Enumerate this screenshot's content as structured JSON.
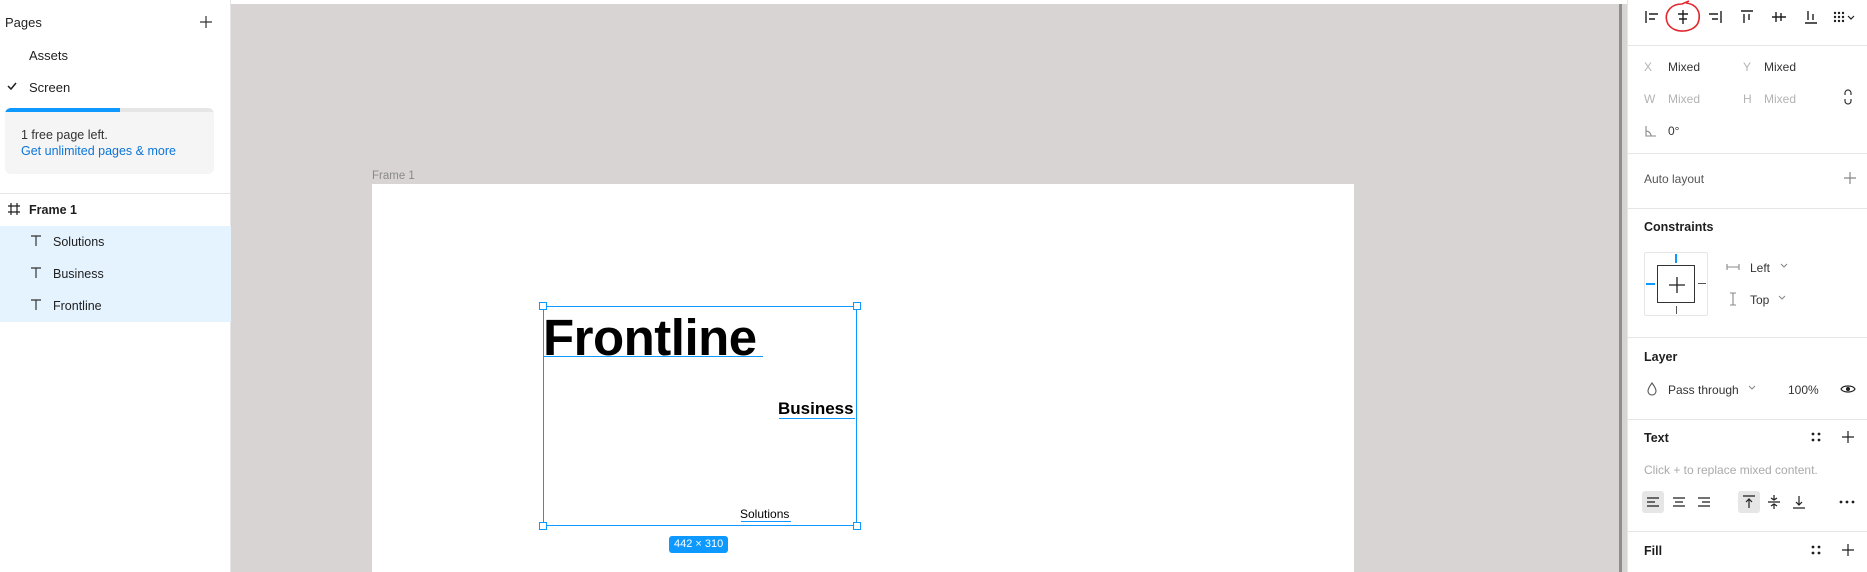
{
  "left_panel": {
    "pages_title": "Pages",
    "pages": [
      {
        "label": "Assets",
        "checked": false
      },
      {
        "label": "Screen",
        "checked": true
      }
    ],
    "quota": {
      "progress": 0.55,
      "message": "1 free page left.",
      "link": "Get unlimited pages & more"
    },
    "layers": [
      {
        "label": "Frame 1",
        "type": "frame",
        "selected": false
      },
      {
        "label": "Solutions",
        "type": "text",
        "selected": true
      },
      {
        "label": "Business",
        "type": "text",
        "selected": true
      },
      {
        "label": "Frontline",
        "type": "text",
        "selected": true
      }
    ]
  },
  "canvas": {
    "frame_label": "Frame 1",
    "texts": {
      "frontline": "Frontline",
      "business": "Business",
      "solutions": "Solutions"
    },
    "selection_size": "442 × 310"
  },
  "right_panel": {
    "position": {
      "x_label": "X",
      "x_value": "Mixed",
      "y_label": "Y",
      "y_value": "Mixed",
      "w_label": "W",
      "w_value": "Mixed",
      "h_label": "H",
      "h_value": "Mixed",
      "rotation": "0°"
    },
    "auto_layout_title": "Auto layout",
    "constraints": {
      "title": "Constraints",
      "horizontal": "Left",
      "vertical": "Top"
    },
    "layer": {
      "title": "Layer",
      "blend": "Pass through",
      "opacity": "100%"
    },
    "text": {
      "title": "Text",
      "hint": "Click + to replace mixed content."
    },
    "fill": {
      "title": "Fill"
    },
    "colors": {
      "accent": "#0d99ff",
      "canvas": "#d9d4d4",
      "annotation": "#e0282e"
    }
  }
}
